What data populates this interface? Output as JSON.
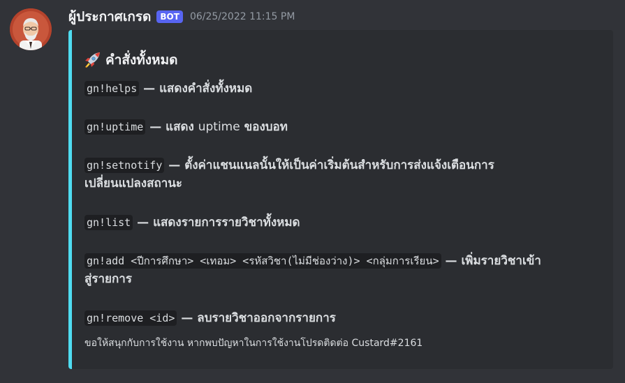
{
  "message": {
    "username": "ผู้ประกาศเกรด",
    "bot_tag": "BOT",
    "timestamp": "06/25/2022 11:15 PM"
  },
  "embed": {
    "accent_color": "#4fdcf0",
    "title_icon": "rocket-icon",
    "title": "คำสั่งทั้งหมด",
    "commands": [
      {
        "code": "gn!helps",
        "separator": " — ",
        "description": "แสดงคำสั่งทั้งหมด"
      },
      {
        "code": "gn!uptime",
        "separator": " — ",
        "description_pre": "แสดง ",
        "description_plain": "uptime",
        "description_post": " ของบอท"
      },
      {
        "code": "gn!setnotify",
        "separator": " — ",
        "description_line1": "ตั้งค่าแชนแนลนั้นให้เป็นค่าเริ่มต้นสำหรับการส่งแจ้งเตือนการ",
        "description_line2": "เปลี่ยนแปลงสถานะ"
      },
      {
        "code": "gn!list",
        "separator": " — ",
        "description": "แสดงรายการรายวิชาทั้งหมด"
      },
      {
        "code": "gn!add <ปีการศึกษา> <เทอม> <รหัสวิชา(ไม่มีช่องว่าง)> <กลุ่มการเรียน>",
        "separator": " — ",
        "description_line1": "เพิ่มรายวิชาเข้า",
        "description_line2": "สู่รายการ"
      },
      {
        "code": "gn!remove <id>",
        "separator": " — ",
        "description": "ลบรายวิชาออกจากรายการ"
      }
    ],
    "footer": "ขอให้สนุกกับการใช้งาน หากพบปัญหาในการใช้งานโปรดติดต่อ Custard#2161"
  }
}
